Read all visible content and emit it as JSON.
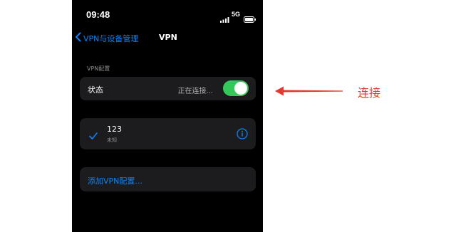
{
  "status_bar": {
    "time": "09:48",
    "network": "5G"
  },
  "nav": {
    "back_label": "VPN与设备管理",
    "title": "VPN"
  },
  "section_header": "VPN配置",
  "status_row": {
    "label": "状态",
    "value": "正在连接...",
    "toggle_on": true
  },
  "vpn_item": {
    "name": "123",
    "subtitle": "未知",
    "selected": true
  },
  "add_config_label": "添加VPN配置...",
  "annotation": {
    "text": "连接"
  },
  "colors": {
    "accent": "#0a84ff",
    "toggle_on": "#34c759",
    "annotation": "#e03a2e",
    "background": "#000000",
    "card": "#1c1c1e"
  },
  "icons": [
    "signal-icon",
    "battery-icon",
    "chevron-left-icon",
    "checkmark-icon",
    "info-icon",
    "arrow-icon"
  ]
}
